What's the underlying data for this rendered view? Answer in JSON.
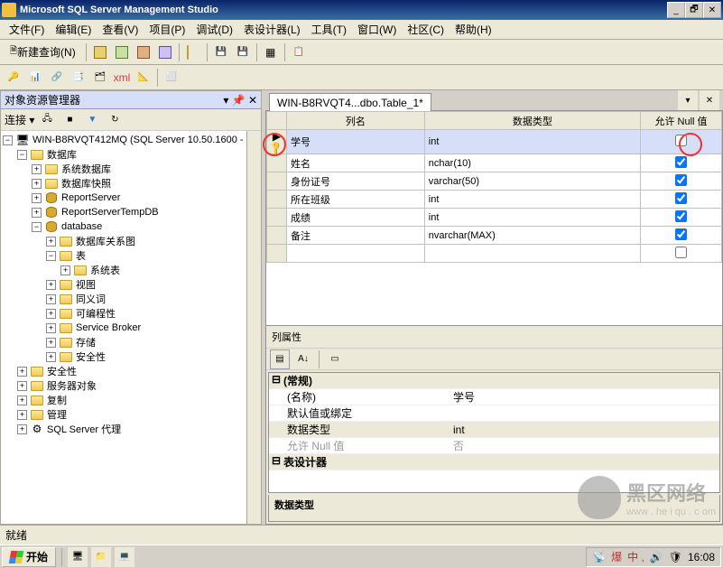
{
  "titlebar": {
    "title": "Microsoft SQL Server Management Studio"
  },
  "menus": {
    "file": "文件(F)",
    "edit": "编辑(E)",
    "view": "查看(V)",
    "project": "项目(P)",
    "debug": "调试(D)",
    "designer": "表设计器(L)",
    "tools": "工具(T)",
    "window": "窗口(W)",
    "community": "社区(C)",
    "help": "帮助(H)"
  },
  "toolbar": {
    "new_query": "新建查询(N)"
  },
  "obj_explorer": {
    "title": "对象资源管理器",
    "connect_label": "连接 ▾",
    "root": "WIN-B8RVQT412MQ (SQL Server 10.50.1600 - ",
    "nodes": {
      "databases": "数据库",
      "sys_db": "系统数据库",
      "db_snapshot": "数据库快照",
      "reportserver": "ReportServer",
      "reportservertemp": "ReportServerTempDB",
      "database": "database",
      "db_diagrams": "数据库关系图",
      "tables": "表",
      "sys_tables": "系统表",
      "views": "视图",
      "synonyms": "同义词",
      "programmability": "可编程性",
      "service_broker": "Service Broker",
      "storage": "存储",
      "security_db": "安全性",
      "security": "安全性",
      "server_objects": "服务器对象",
      "replication": "复制",
      "management": "管理",
      "sql_agent": "SQL Server 代理"
    }
  },
  "designer": {
    "tab_title": "WIN-B8RVQT4...dbo.Table_1*",
    "headers": {
      "colname": "列名",
      "datatype": "数据类型",
      "allownull": "允许 Null 值"
    },
    "columns": [
      {
        "name": "学号",
        "type": "int",
        "null": false,
        "pk": true
      },
      {
        "name": "姓名",
        "type": "nchar(10)",
        "null": true
      },
      {
        "name": "身份证号",
        "type": "varchar(50)",
        "null": true
      },
      {
        "name": "所在班级",
        "type": "int",
        "null": true
      },
      {
        "name": "成绩",
        "type": "int",
        "null": true
      },
      {
        "name": "备注",
        "type": "nvarchar(MAX)",
        "null": true
      }
    ]
  },
  "colprops": {
    "title": "列属性",
    "general": "(常规)",
    "name_lbl": "(名称)",
    "name_val": "学号",
    "default_lbl": "默认值或绑定",
    "default_val": "",
    "datatype_lbl": "数据类型",
    "datatype_val": "int",
    "allownull_lbl": "允许 Null 值",
    "allownull_val": "否",
    "designer_section": "表设计器",
    "desc": "数据类型"
  },
  "statusbar": {
    "ready": "就绪"
  },
  "taskbar": {
    "start": "开始",
    "lang": "中 ,",
    "time": "16:08"
  },
  "watermark": {
    "brand": "黑区网络",
    "url": "www . he i qu . c om"
  }
}
